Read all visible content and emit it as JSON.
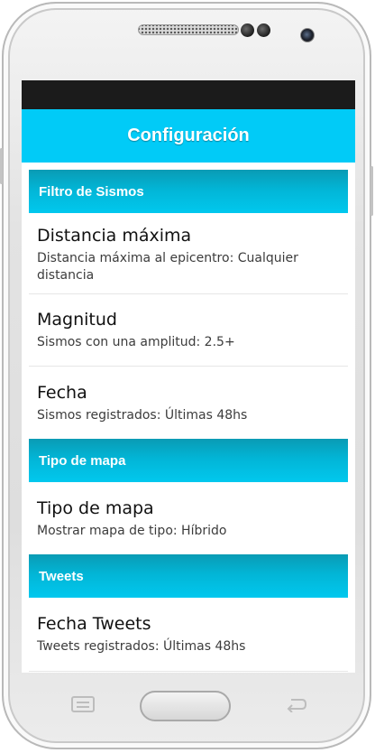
{
  "app": {
    "title": "Configuración"
  },
  "sections": [
    {
      "header": "Filtro de Sismos",
      "items": [
        {
          "title": "Distancia máxima",
          "summary": "Distancia máxima al epicentro: Cualquier distancia"
        },
        {
          "title": "Magnitud",
          "summary": "Sismos con una amplitud: 2.5+"
        },
        {
          "title": "Fecha",
          "summary": "Sismos registrados: Últimas 48hs"
        }
      ]
    },
    {
      "header": "Tipo de mapa",
      "items": [
        {
          "title": "Tipo de mapa",
          "summary": "Mostrar mapa de tipo: Híbrido"
        }
      ]
    },
    {
      "header": "Tweets",
      "items": [
        {
          "title": "Fecha Tweets",
          "summary": "Tweets registrados: Últimas 48hs"
        }
      ]
    }
  ],
  "colors": {
    "appbar": "#01cbf7",
    "category_header": "#02b5d6",
    "status_bar": "#1b1b1b"
  },
  "hardware_keys": {
    "left": "menu-icon",
    "right": "back-icon"
  }
}
